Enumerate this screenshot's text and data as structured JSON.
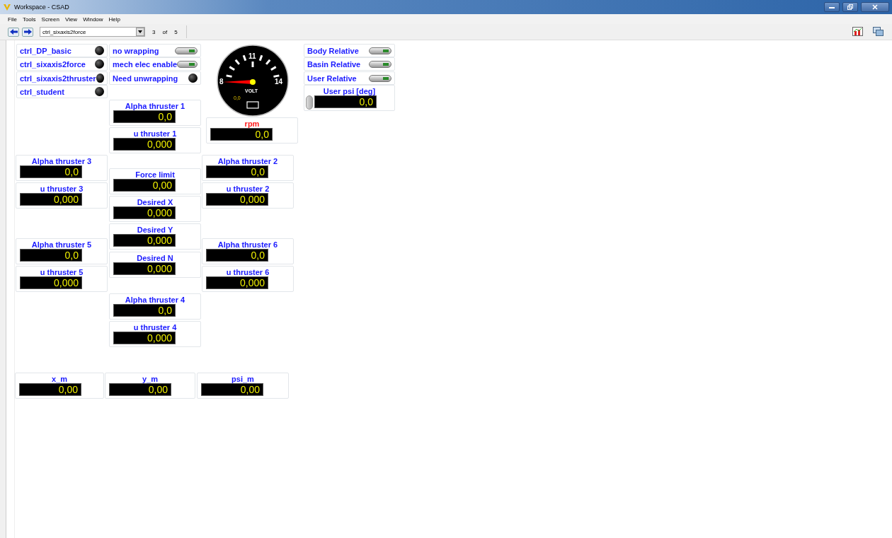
{
  "window": {
    "title": "Workspace - CSAD"
  },
  "menu": [
    "File",
    "Tools",
    "Screen",
    "View",
    "Window",
    "Help"
  ],
  "toolbar": {
    "screen": "ctrl_sixaxis2force",
    "page": "3",
    "of": "of",
    "total": "5"
  },
  "widgets": [
    {
      "kind": "led",
      "label": "ctrl_DP_basic",
      "on": false
    },
    {
      "kind": "led",
      "label": "ctrl_sixaxis2force",
      "on": false
    },
    {
      "kind": "led",
      "label": "ctrl_sixaxis2thruster",
      "on": false
    },
    {
      "kind": "led",
      "label": "ctrl_student",
      "on": false
    },
    {
      "kind": "toggle",
      "label": "no wrapping",
      "on": false
    },
    {
      "kind": "toggle",
      "label": "mech elec enable",
      "on": false
    },
    {
      "kind": "led",
      "label": "Need unwrapping",
      "on": false
    },
    {
      "kind": "gauge",
      "scale": [
        "8",
        "11",
        "14"
      ],
      "unit": "VOLT",
      "reading": "0,0"
    },
    {
      "kind": "toggle",
      "label": "Body Relative",
      "on": false
    },
    {
      "kind": "toggle",
      "label": "Basin Relative",
      "on": false
    },
    {
      "kind": "toggle",
      "label": "User Relative",
      "on": false
    },
    {
      "kind": "spin",
      "label": "User psi [deg]",
      "value": "0,0",
      "color": "#1a1aff"
    },
    {
      "kind": "display",
      "label": "Alpha thruster 1",
      "value": "0,0",
      "color": "#1a1aff"
    },
    {
      "kind": "display",
      "label": "rpm",
      "value": "0,0",
      "color": "#ff1a1a"
    },
    {
      "kind": "display",
      "label": "u thruster 1",
      "value": "0,000",
      "color": "#1a1aff"
    },
    {
      "kind": "display",
      "label": "Alpha thruster 3",
      "value": "0,0",
      "color": "#1a1aff"
    },
    {
      "kind": "display",
      "label": "Alpha thruster 2",
      "value": "0,0",
      "color": "#1a1aff"
    },
    {
      "kind": "display",
      "label": "Force limit",
      "value": "0,00",
      "color": "#1a1aff"
    },
    {
      "kind": "display",
      "label": "u thruster 3",
      "value": "0,000",
      "color": "#1a1aff"
    },
    {
      "kind": "display",
      "label": "u thruster 2",
      "value": "0,000",
      "color": "#1a1aff"
    },
    {
      "kind": "display",
      "label": "Desired X",
      "value": "0,000",
      "color": "#1a1aff"
    },
    {
      "kind": "display",
      "label": "Desired Y",
      "value": "0,000",
      "color": "#1a1aff"
    },
    {
      "kind": "display",
      "label": "Alpha thruster 5",
      "value": "0,0",
      "color": "#1a1aff"
    },
    {
      "kind": "display",
      "label": "Alpha thruster 6",
      "value": "0,0",
      "color": "#1a1aff"
    },
    {
      "kind": "display",
      "label": "Desired N",
      "value": "0,000",
      "color": "#1a1aff"
    },
    {
      "kind": "display",
      "label": "u thruster 5",
      "value": "0,000",
      "color": "#1a1aff"
    },
    {
      "kind": "display",
      "label": "u thruster 6",
      "value": "0,000",
      "color": "#1a1aff"
    },
    {
      "kind": "display",
      "label": "Alpha thruster 4",
      "value": "0,0",
      "color": "#1a1aff"
    },
    {
      "kind": "display",
      "label": "u thruster 4",
      "value": "0,000",
      "color": "#1a1aff"
    },
    {
      "kind": "display",
      "label": "x_m",
      "value": "0,00",
      "color": "#1a1aff"
    },
    {
      "kind": "display",
      "label": "y_m",
      "value": "0,00",
      "color": "#1a1aff"
    },
    {
      "kind": "display",
      "label": "psi_m",
      "value": "0,00",
      "color": "#1a1aff"
    }
  ]
}
